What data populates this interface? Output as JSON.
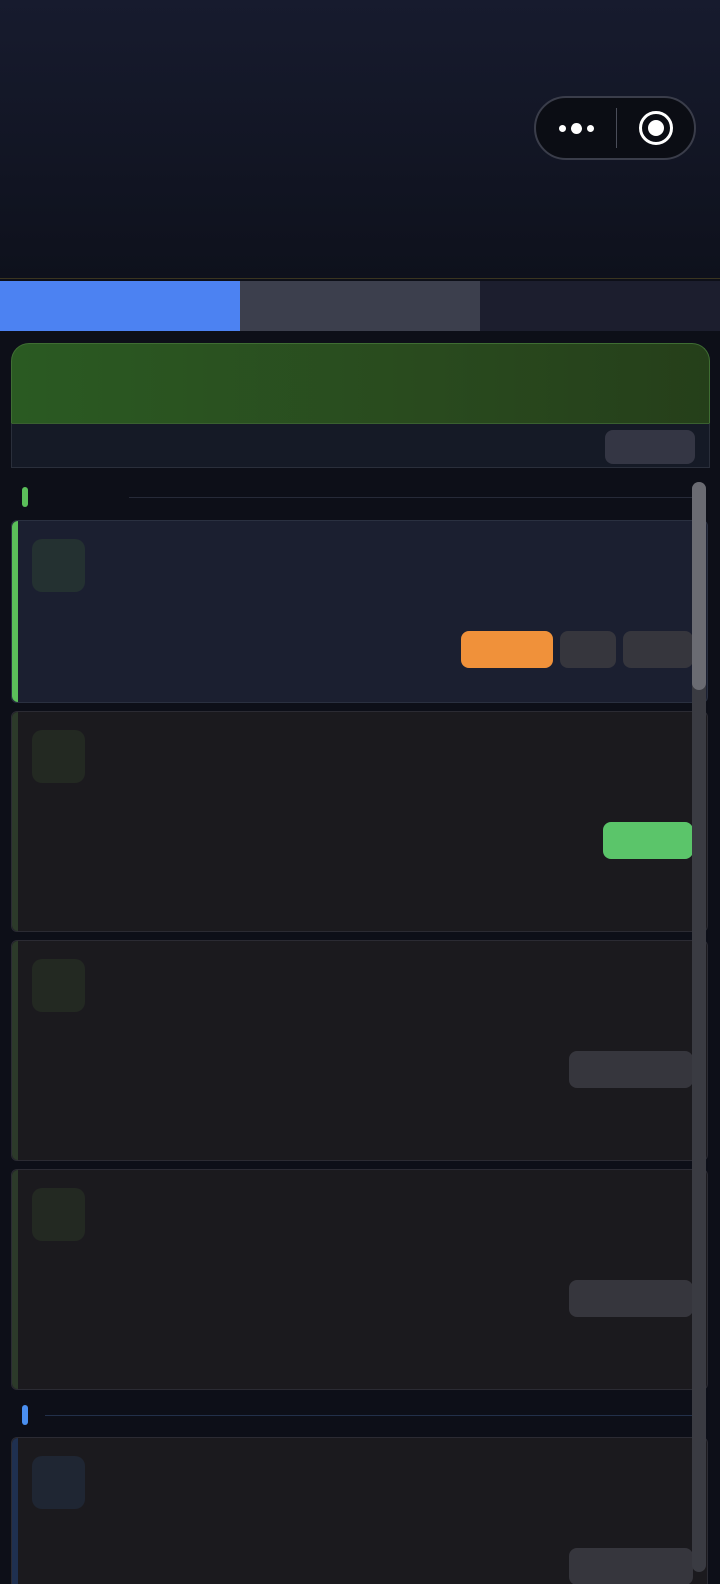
{
  "header": {
    "title": "",
    "capsule": {
      "more_icon": "more-dots-icon",
      "close_icon": "target-circle-icon"
    }
  },
  "tabs": [
    {
      "label": "",
      "color": "#4c82f2",
      "state": "active"
    },
    {
      "label": "",
      "color": "#3c3f4d",
      "state": "inactive"
    },
    {
      "label": "",
      "color": "#1c1e2e",
      "state": "inactive"
    }
  ],
  "banner": {
    "title": "",
    "subtitle": "",
    "button_label": ""
  },
  "sections": [
    {
      "label": "",
      "accent": "#5bbf5a"
    },
    {
      "label": "",
      "accent": "#4a8ff0"
    }
  ],
  "cards": [
    {
      "title": "",
      "subtitle": "",
      "accent": "#5bbf5a",
      "background": "#1b1f30",
      "icon_bg": "#243131",
      "actions": [
        {
          "label": "",
          "color": "#f0913a"
        },
        {
          "label": "",
          "color": "#36363d"
        },
        {
          "label": "",
          "color": "#36363d"
        }
      ]
    },
    {
      "title": "",
      "subtitle": "",
      "accent": "#2c3a2a",
      "background": "#1b1a1e",
      "icon_bg": "#232922",
      "actions": [
        {
          "label": "",
          "color": "#5bc56a"
        }
      ]
    },
    {
      "title": "",
      "subtitle": "",
      "accent": "#2c3a2a",
      "background": "#1b1a1e",
      "icon_bg": "#232922",
      "actions": [
        {
          "label": "",
          "color": "#36363d"
        }
      ]
    },
    {
      "title": "",
      "subtitle": "",
      "accent": "#2c3a2a",
      "background": "#1b1a1e",
      "icon_bg": "#232922",
      "actions": [
        {
          "label": "",
          "color": "#36363d"
        }
      ]
    },
    {
      "title": "",
      "subtitle": "",
      "accent": "#1f3050",
      "background": "#1b1a1e",
      "icon_bg": "#1f2633",
      "actions": [
        {
          "label": "",
          "color": "#36363d"
        }
      ]
    }
  ],
  "scroll": {
    "position": 0.0,
    "visible_fraction": 0.19
  }
}
